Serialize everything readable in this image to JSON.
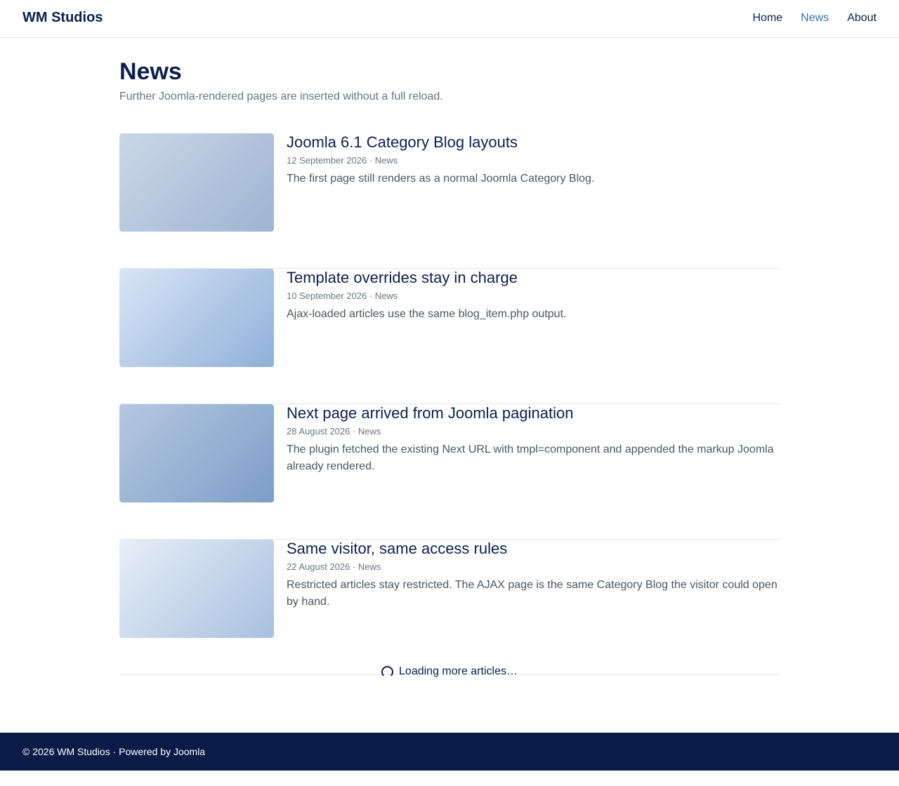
{
  "header": {
    "brand": "WM Studios",
    "nav": [
      {
        "label": "Home",
        "active": false
      },
      {
        "label": "News",
        "active": true
      },
      {
        "label": "About",
        "active": false
      }
    ]
  },
  "page": {
    "title": "News",
    "subtitle": "Further Joomla-rendered pages are inserted without a full reload."
  },
  "articles": [
    {
      "title": "Joomla 6.1 Category Blog layouts",
      "meta": "12 September 2026 · News",
      "intro": "The first page still renders as a normal Joomla Category Blog.",
      "thumb_colors": [
        "#cbd7e6",
        "#9eb4d2"
      ]
    },
    {
      "title": "Template overrides stay in charge",
      "meta": "10 September 2026 · News",
      "intro": "Ajax-loaded articles use the same blog_item.php output.",
      "thumb_colors": [
        "#d8e5f5",
        "#8fb0d9"
      ]
    },
    {
      "title": "Next page arrived from Joomla pagination",
      "meta": "28 August 2026 · News",
      "intro": "The plugin fetched the existing Next URL with tmpl=component and appended the markup Joomla already rendered.",
      "thumb_colors": [
        "#b5c8e1",
        "#7d9ec8"
      ]
    },
    {
      "title": "Same visitor, same access rules",
      "meta": "22 August 2026 · News",
      "intro": "Restricted articles stay restricted. The AJAX page is the same Category Blog the visitor could open by hand.",
      "thumb_colors": [
        "#e8eff8",
        "#a8c0df"
      ]
    }
  ],
  "loader": {
    "text": "Loading more articles…"
  },
  "footer": {
    "text": "© 2026 WM Studios · Powered by Joomla"
  }
}
